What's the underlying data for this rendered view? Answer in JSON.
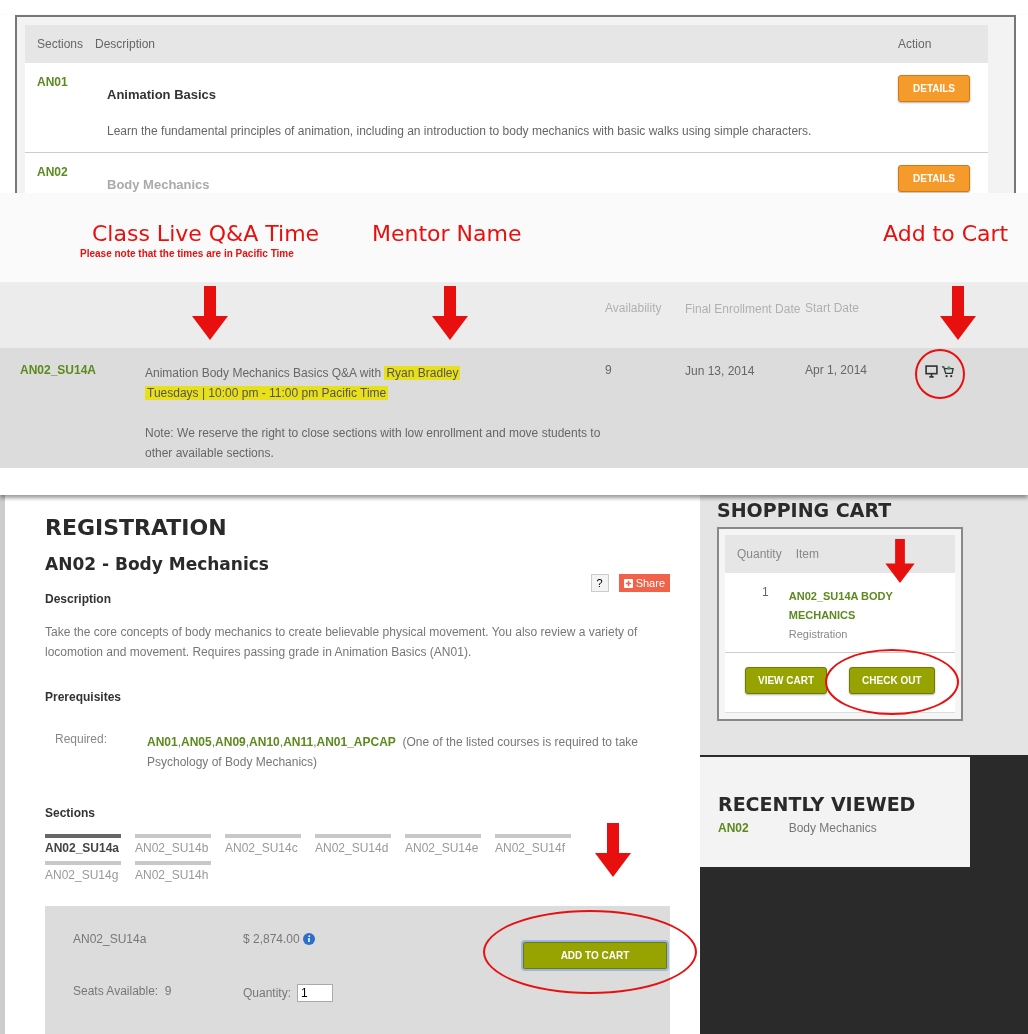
{
  "course_table": {
    "columns": [
      "Sections",
      "Description",
      "Action"
    ],
    "courses": [
      {
        "code": "AN01",
        "title": "Animation Basics",
        "description": "Learn the fundamental principles of animation, including an introduction to body mechanics with basic walks using simple characters.",
        "action": "DETAILS"
      },
      {
        "code": "AN02",
        "title": "Body Mechanics",
        "action": "DETAILS"
      }
    ]
  },
  "annotations": {
    "qa_label": "Class Live Q&A Time",
    "qa_note": "Please note that the times are in Pacific Time",
    "mentor_label": "Mentor Name",
    "cart_label": "Add to Cart"
  },
  "section_table": {
    "columns": [
      "Availability",
      "Final Enrollment Date",
      "Start Date"
    ],
    "rows": [
      {
        "code": "AN02_SU14A",
        "session": "Animation Body Mechanics Basics Q&A with",
        "mentor": "Ryan Bradley",
        "schedule": "Tuesdays | 10:00 pm - 11:00 pm Pacific Time",
        "note": "Note: We reserve the right to close sections with low enrollment and move students to other available sections.",
        "availability": "9",
        "final_enrollment": "Jun 13, 2014",
        "start_date": "Apr 1, 2014"
      }
    ]
  },
  "registration": {
    "title": "REGISTRATION",
    "course": "AN02 - Body Mechanics",
    "help": "?",
    "share": "Share",
    "description_heading": "Description",
    "description": "Take the core concepts of body mechanics to create believable physical movement. You also review a variety of locomotion and movement. Requires passing grade in Animation Basics (AN01).",
    "prerequisites_heading": "Prerequisites",
    "required_label": "Required:",
    "prerequisites": [
      "AN01",
      "AN05",
      "AN09",
      "AN10",
      "AN11",
      "AN01_APCAP"
    ],
    "prerequisite_separator": ",",
    "prerequisite_note": "(One of the listed courses is required to take Psychology of Body Mechanics)",
    "sections_heading": "Sections",
    "sections": [
      {
        "label": "AN02_SU14a",
        "selected": true
      },
      {
        "label": "AN02_SU14b",
        "selected": false
      },
      {
        "label": "AN02_SU14c",
        "selected": false
      },
      {
        "label": "AN02_SU14d",
        "selected": false
      },
      {
        "label": "AN02_SU14e",
        "selected": false
      },
      {
        "label": "AN02_SU14f",
        "selected": false
      },
      {
        "label": "AN02_SU14g",
        "selected": false
      },
      {
        "label": "AN02_SU14h",
        "selected": false
      }
    ],
    "detail": {
      "section": "AN02_SU14a",
      "price": "$ 2,874.00",
      "button": "ADD TO CART",
      "seats_label": "Seats Available:",
      "seats": "9",
      "quantity_label": "Quantity:",
      "quantity": "1"
    }
  },
  "shopping_cart": {
    "title": "SHOPPING CART",
    "columns": [
      "Quantity",
      "Item"
    ],
    "items": [
      {
        "quantity": "1",
        "name": "AN02_SU14A BODY MECHANICS",
        "type": "Registration"
      }
    ],
    "buttons": [
      "VIEW CART",
      "CHECK OUT"
    ]
  },
  "recently_viewed": {
    "title": "RECENTLY VIEWED",
    "items": [
      {
        "code": "AN02",
        "name": "Body Mechanics"
      }
    ]
  }
}
